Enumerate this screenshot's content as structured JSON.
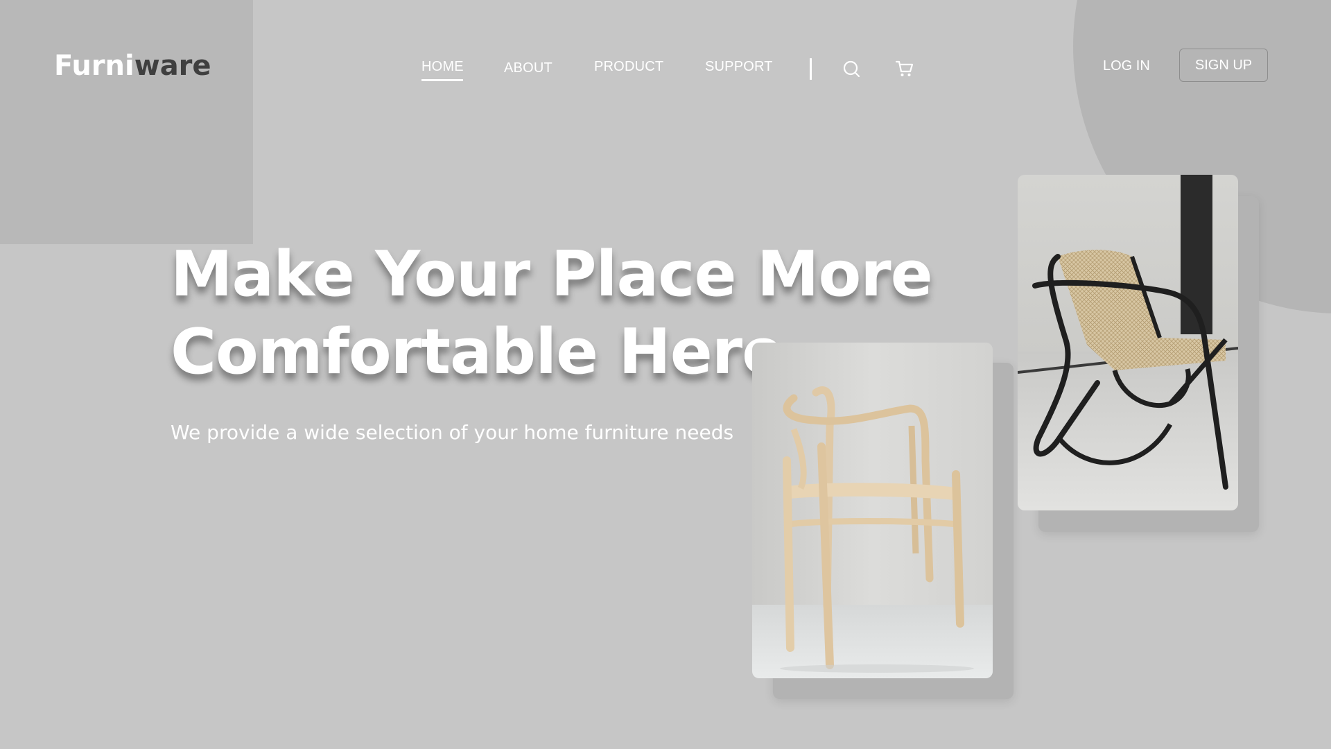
{
  "brand": {
    "part1": "Furni",
    "part2": "ware"
  },
  "nav": {
    "items": [
      {
        "label": "HOME",
        "active": true
      },
      {
        "label": "ABOUT",
        "active": false
      },
      {
        "label": "PRODUCT",
        "active": false
      },
      {
        "label": "SUPPORT",
        "active": false
      }
    ],
    "icons": [
      "search-icon",
      "cart-icon"
    ]
  },
  "auth": {
    "login_label": "LOG IN",
    "signup_label": "SIGN UP"
  },
  "hero": {
    "title_line1": "Make Your Place More",
    "title_line2": "Comfortable Here",
    "subtitle": "We provide a wide selection of your home furniture needs"
  },
  "images": [
    {
      "name": "wooden-chair-image"
    },
    {
      "name": "rattan-lounge-chair-image"
    }
  ],
  "colors": {
    "background": "#c6c6c6",
    "text": "#ffffff",
    "brand_dark": "#3f3f3f"
  }
}
